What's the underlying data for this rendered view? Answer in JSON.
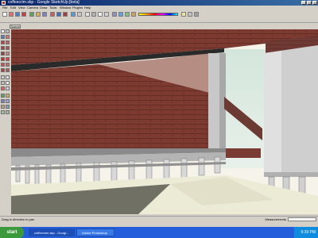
{
  "window": {
    "title": "coffeecrim.skp - Google SketchUp [beta]",
    "min_label": "_",
    "max_label": "□",
    "close_label": "×"
  },
  "menu": [
    "File",
    "Edit",
    "View",
    "Camera",
    "Draw",
    "Tools",
    "Window",
    "Plugins",
    "Help"
  ],
  "scene_tab": "Scene",
  "status": {
    "text": "Drag in direction to pan",
    "measurements_label": "Measurements"
  },
  "taskbar": {
    "start_label": "start",
    "tasks": [
      "coffeecrim.skp - Googl...",
      "Adobe Photoshop"
    ],
    "clock": "9:39 PM"
  },
  "icons": {
    "toolbar": [
      "select-icon",
      "eraser-icon",
      "paint-bucket-icon",
      "move-icon",
      "orbit-icon",
      "pan-icon",
      "zoom-icon",
      "line-icon",
      "rectangle-icon",
      "circle-icon",
      "push-pull-icon",
      "tape-measure-icon"
    ],
    "left": [
      "select-icon",
      "component-icon",
      "paint-bucket-icon",
      "eraser-icon",
      "rectangle-icon",
      "line-icon",
      "circle-icon",
      "arc-icon",
      "polygon-icon",
      "freehand-icon",
      "move-icon",
      "push-pull-icon",
      "rotate-icon",
      "follow-me-icon",
      "scale-icon",
      "offset-icon",
      "tape-measure-icon",
      "dimension-icon",
      "protractor-icon",
      "text-icon",
      "axes-icon",
      "3d-text-icon",
      "orbit-icon",
      "pan-icon",
      "zoom-icon",
      "walk-icon",
      "look-around-icon",
      "section-icon"
    ]
  },
  "colors": {
    "titlebar": "#0a246a",
    "brick": "#7c3a30",
    "sky": "#d4e6dc",
    "ground": "#ecebd6"
  }
}
